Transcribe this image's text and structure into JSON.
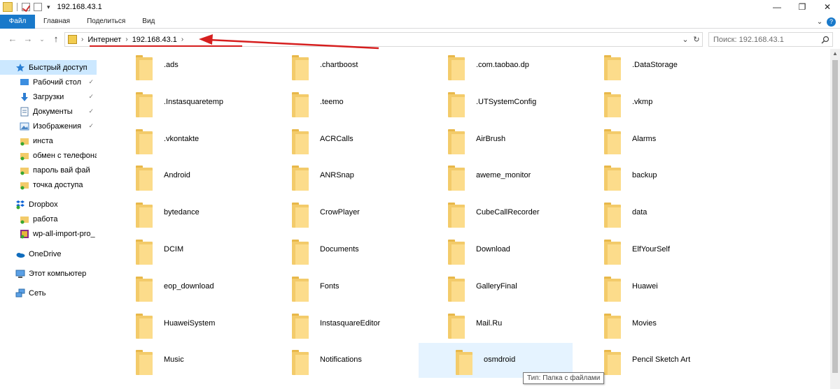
{
  "window": {
    "title": "192.168.43.1",
    "controls": {
      "minimize": "—",
      "restore": "❐",
      "close": "✕"
    }
  },
  "ribbon": {
    "tabs": [
      "Файл",
      "Главная",
      "Поделиться",
      "Вид"
    ],
    "expand_glyph": "⌄",
    "help_glyph": "?"
  },
  "nav": {
    "back": "←",
    "forward": "→",
    "recent": "⌄",
    "up": "↑",
    "breadcrumb": [
      "Интернет",
      "192.168.43.1"
    ],
    "address_dropdown": "⌄",
    "refresh": "↻",
    "search_placeholder": "Поиск: 192.168.43.1"
  },
  "sidebar": {
    "items": [
      {
        "label": "Быстрый доступ",
        "icon": "star-icon",
        "selected": true
      },
      {
        "label": "Рабочий стол",
        "icon": "desktop-icon",
        "pinned": true
      },
      {
        "label": "Загрузки",
        "icon": "download-icon",
        "pinned": true
      },
      {
        "label": "Документы",
        "icon": "documents-icon",
        "pinned": true
      },
      {
        "label": "Изображения",
        "icon": "pictures-icon",
        "pinned": true
      },
      {
        "label": "инста",
        "icon": "folder-sync-icon"
      },
      {
        "label": "обмен с телефона",
        "icon": "folder-sync-icon"
      },
      {
        "label": "пароль вай фай",
        "icon": "folder-sync-icon"
      },
      {
        "label": "точка доступа",
        "icon": "folder-sync-icon"
      },
      {
        "label": "Dropbox",
        "icon": "dropbox-icon"
      },
      {
        "label": "работа",
        "icon": "folder-sync-icon"
      },
      {
        "label": "wp-all-import-pro_",
        "icon": "archive-icon"
      },
      {
        "label": "OneDrive",
        "icon": "onedrive-icon"
      },
      {
        "label": "Этот компьютер",
        "icon": "computer-icon"
      },
      {
        "label": "Сеть",
        "icon": "network-icon"
      }
    ],
    "pin_glyph": "📌"
  },
  "folders": [
    ".ads",
    ".chartboost",
    ".com.taobao.dp",
    ".DataStorage",
    ".Instasquaretemp",
    ".teemo",
    ".UTSystemConfig",
    ".vkmp",
    ".vkontakte",
    "ACRCalls",
    "AirBrush",
    "Alarms",
    "Android",
    "ANRSnap",
    "aweme_monitor",
    "backup",
    "bytedance",
    "CrowPlayer",
    "CubeCallRecorder",
    "data",
    "DCIM",
    "Documents",
    "Download",
    "ElfYourSelf",
    "eop_download",
    "Fonts",
    "GalleryFinal",
    "Huawei",
    "HuaweiSystem",
    "InstasquareEditor",
    "Mail.Ru",
    "Movies",
    "Music",
    "Notifications",
    "osmdroid",
    "Pencil Sketch Art"
  ],
  "hovered_folder": "osmdroid",
  "tooltip": "Тип: Папка с файлами",
  "colors": {
    "accent": "#1979ca",
    "selection": "#cce8ff",
    "hover": "#e5f3ff",
    "folder": "#f3cb6a",
    "annotation_arrow": "#d61f1f"
  }
}
